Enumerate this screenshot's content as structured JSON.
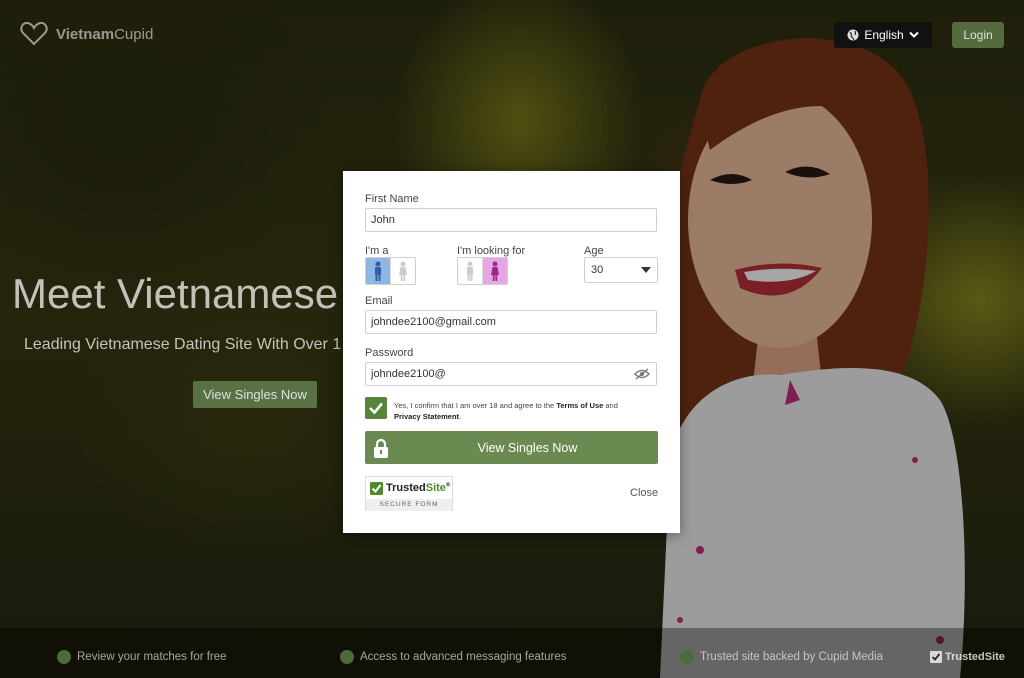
{
  "header": {
    "logo_text_bold": "Vietnam",
    "logo_text_light": "Cupid",
    "language": "English",
    "login_label": "Login"
  },
  "hero": {
    "title": "Meet Vietnamese",
    "subtitle": "Leading Vietnamese Dating Site With Over 1",
    "cta_label": "View Singles Now"
  },
  "form": {
    "first_name_label": "First Name",
    "first_name_value": "John",
    "im_a_label": "I'm a",
    "im_a_selected": "male",
    "looking_for_label": "I'm looking for",
    "looking_for_selected": "female",
    "age_label": "Age",
    "age_value": "30",
    "email_label": "Email",
    "email_value": "johndee2100@gmail.com",
    "password_label": "Password",
    "password_value": "johndee2100@",
    "terms_prefix": "Yes, I confirm that I am over 18 and agree to the",
    "terms_link": "Terms of Use",
    "terms_and": "and",
    "privacy_link": "Privacy Statement",
    "terms_period": ".",
    "terms_checked": true,
    "submit_label": "View Singles Now",
    "trusted_word": "Trusted",
    "trusted_site": "Site",
    "trusted_tm": "®",
    "secure_form": "SECURE FORM",
    "close_label": "Close"
  },
  "footer": {
    "features": [
      "Review your matches for free",
      "Access to advanced messaging features",
      "Trusted site backed by Cupid Media"
    ],
    "trusted_site_label": "TrustedSite"
  },
  "colors": {
    "accent_green": "#6b8a52",
    "male_selected": "#8fb5e2",
    "female_selected": "#e6a6e3"
  }
}
